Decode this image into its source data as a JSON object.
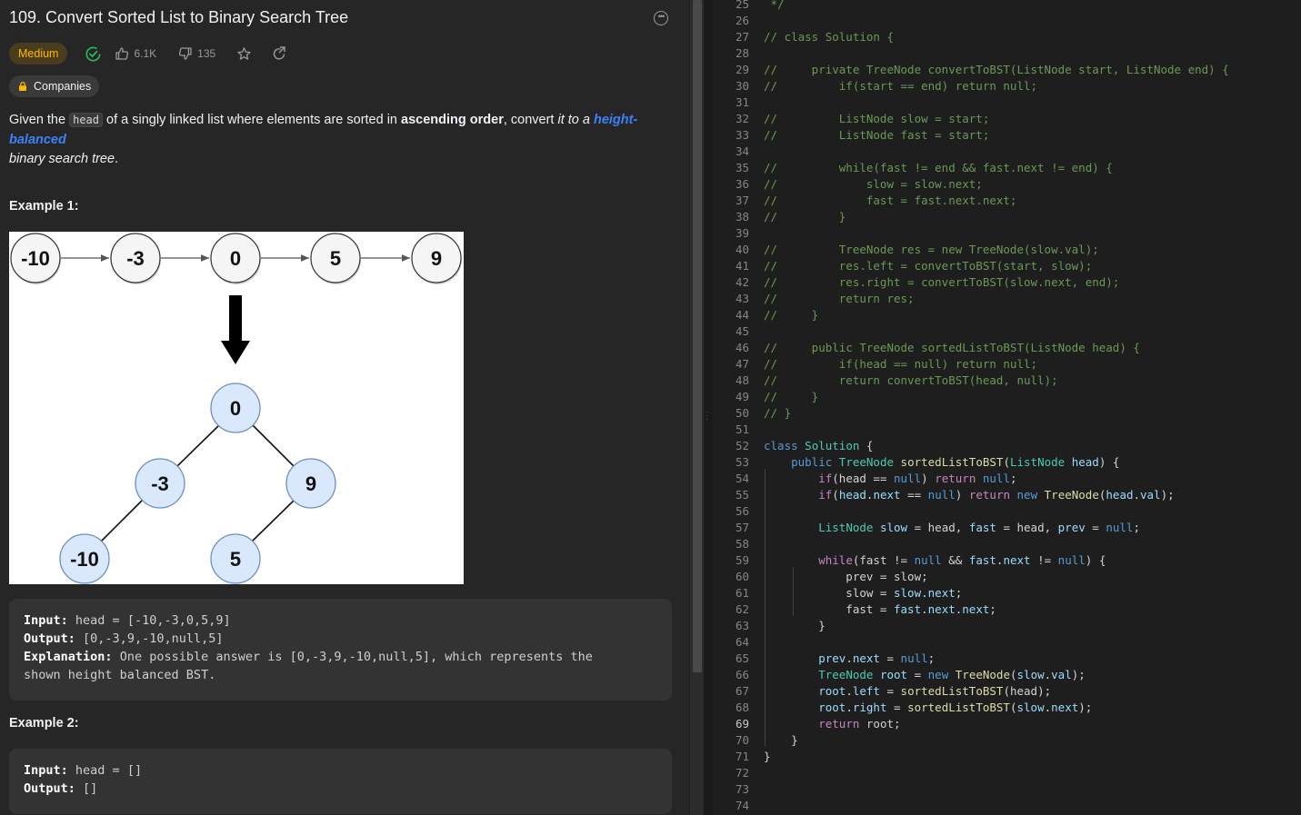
{
  "problem": {
    "title": "109. Convert Sorted List to Binary Search Tree",
    "difficulty": "Medium",
    "likes": "6.1K",
    "dislikes": "135",
    "companies_label": "Companies",
    "desc_p1": "Given the ",
    "desc_code": "head",
    "desc_p2": " of a singly linked list where elements are sorted in ",
    "desc_bold": "ascending order",
    "desc_p3": ", convert ",
    "desc_italic": "it to a ",
    "desc_link": "height-balanced",
    "desc_italic2": "binary search tree",
    "desc_end": ".",
    "example1_label": "Example 1:",
    "example2_label": "Example 2:",
    "figure": {
      "list": [
        "-10",
        "-3",
        "0",
        "5",
        "9"
      ],
      "tree": {
        "root": "0",
        "left": "-3",
        "right": "9",
        "left_left": "-10",
        "right_left": "5"
      }
    },
    "example1": {
      "input_label": "Input:",
      "input": "head = [-10,-3,0,5,9]",
      "output_label": "Output:",
      "output": "[0,-3,9,-10,null,5]",
      "expl_label": "Explanation:",
      "expl1": "One possible answer is [0,-3,9,-10,null,5], which represents the",
      "expl2": "shown height balanced BST."
    },
    "example2": {
      "input_label": "Input:",
      "input": "head = []",
      "output_label": "Output:",
      "output": "[]"
    }
  },
  "editor": {
    "current_line": 69,
    "lines": [
      {
        "n": 25,
        "t": [
          [
            "cm",
            " */"
          ]
        ]
      },
      {
        "n": 26,
        "t": []
      },
      {
        "n": 27,
        "t": [
          [
            "cm",
            "// class Solution {"
          ]
        ]
      },
      {
        "n": 28,
        "t": []
      },
      {
        "n": 29,
        "t": [
          [
            "cm",
            "//     private TreeNode convertToBST(ListNode start, ListNode end) {"
          ]
        ]
      },
      {
        "n": 30,
        "t": [
          [
            "cm",
            "//         if(start == end) return null;"
          ]
        ]
      },
      {
        "n": 31,
        "t": []
      },
      {
        "n": 32,
        "t": [
          [
            "cm",
            "//         ListNode slow = start;"
          ]
        ]
      },
      {
        "n": 33,
        "t": [
          [
            "cm",
            "//         ListNode fast = start;"
          ]
        ]
      },
      {
        "n": 34,
        "t": []
      },
      {
        "n": 35,
        "t": [
          [
            "cm",
            "//         while(fast != end && fast.next != end) {"
          ]
        ]
      },
      {
        "n": 36,
        "t": [
          [
            "cm",
            "//             slow = slow.next;"
          ]
        ]
      },
      {
        "n": 37,
        "t": [
          [
            "cm",
            "//             fast = fast.next.next;"
          ]
        ]
      },
      {
        "n": 38,
        "t": [
          [
            "cm",
            "//         }"
          ]
        ]
      },
      {
        "n": 39,
        "t": []
      },
      {
        "n": 40,
        "t": [
          [
            "cm",
            "//         TreeNode res = new TreeNode(slow.val);"
          ]
        ]
      },
      {
        "n": 41,
        "t": [
          [
            "cm",
            "//         res.left = convertToBST(start, slow);"
          ]
        ]
      },
      {
        "n": 42,
        "t": [
          [
            "cm",
            "//         res.right = convertToBST(slow.next, end);"
          ]
        ]
      },
      {
        "n": 43,
        "t": [
          [
            "cm",
            "//         return res;"
          ]
        ]
      },
      {
        "n": 44,
        "t": [
          [
            "cm",
            "//     }"
          ]
        ]
      },
      {
        "n": 45,
        "t": []
      },
      {
        "n": 46,
        "t": [
          [
            "cm",
            "//     public TreeNode sortedListToBST(ListNode head) {"
          ]
        ]
      },
      {
        "n": 47,
        "t": [
          [
            "cm",
            "//         if(head == null) return null;"
          ]
        ]
      },
      {
        "n": 48,
        "t": [
          [
            "cm",
            "//         return convertToBST(head, null);"
          ]
        ]
      },
      {
        "n": 49,
        "t": [
          [
            "cm",
            "//     }"
          ]
        ]
      },
      {
        "n": 50,
        "t": [
          [
            "cm",
            "// }"
          ]
        ]
      },
      {
        "n": 51,
        "t": []
      },
      {
        "n": 52,
        "t": [
          [
            "kw",
            "class"
          ],
          [
            "",
            " "
          ],
          [
            "ty",
            "Solution"
          ],
          [
            "",
            " {"
          ]
        ]
      },
      {
        "n": 53,
        "t": [
          [
            "",
            "    "
          ],
          [
            "kw",
            "public"
          ],
          [
            "",
            " "
          ],
          [
            "ty",
            "TreeNode"
          ],
          [
            "",
            " "
          ],
          [
            "fn",
            "sortedListToBST"
          ],
          [
            "",
            "("
          ],
          [
            "ty",
            "ListNode"
          ],
          [
            "",
            " "
          ],
          [
            "vr",
            "head"
          ],
          [
            "",
            ") {"
          ]
        ]
      },
      {
        "n": 54,
        "t": [
          [
            "",
            "        "
          ],
          [
            "kw2",
            "if"
          ],
          [
            "",
            "(head == "
          ],
          [
            "kw",
            "null"
          ],
          [
            "",
            ") "
          ],
          [
            "kw2",
            "return"
          ],
          [
            "",
            " "
          ],
          [
            "kw",
            "null"
          ],
          [
            "",
            ";"
          ]
        ]
      },
      {
        "n": 55,
        "t": [
          [
            "",
            "        "
          ],
          [
            "kw2",
            "if"
          ],
          [
            "",
            "("
          ],
          [
            "vr",
            "head"
          ],
          [
            "",
            "."
          ],
          [
            "vr",
            "next"
          ],
          [
            "",
            " == "
          ],
          [
            "kw",
            "null"
          ],
          [
            "",
            ") "
          ],
          [
            "kw2",
            "return"
          ],
          [
            "",
            " "
          ],
          [
            "kw",
            "new"
          ],
          [
            "",
            " "
          ],
          [
            "fn",
            "TreeNode"
          ],
          [
            "",
            "("
          ],
          [
            "vr",
            "head"
          ],
          [
            "",
            "."
          ],
          [
            "vr",
            "val"
          ],
          [
            "",
            ");"
          ]
        ]
      },
      {
        "n": 56,
        "t": []
      },
      {
        "n": 57,
        "t": [
          [
            "",
            "        "
          ],
          [
            "ty",
            "ListNode"
          ],
          [
            "",
            " "
          ],
          [
            "vr",
            "slow"
          ],
          [
            "",
            " = head, "
          ],
          [
            "vr",
            "fast"
          ],
          [
            "",
            " = head, "
          ],
          [
            "vr",
            "prev"
          ],
          [
            "",
            " = "
          ],
          [
            "kw",
            "null"
          ],
          [
            "",
            ";"
          ]
        ]
      },
      {
        "n": 58,
        "t": []
      },
      {
        "n": 59,
        "t": [
          [
            "",
            "        "
          ],
          [
            "kw2",
            "while"
          ],
          [
            "",
            "(fast != "
          ],
          [
            "kw",
            "null"
          ],
          [
            "",
            " && "
          ],
          [
            "vr",
            "fast"
          ],
          [
            "",
            "."
          ],
          [
            "vr",
            "next"
          ],
          [
            "",
            " != "
          ],
          [
            "kw",
            "null"
          ],
          [
            "",
            ") {"
          ]
        ]
      },
      {
        "n": 60,
        "t": [
          [
            "",
            "            prev = slow;"
          ]
        ]
      },
      {
        "n": 61,
        "t": [
          [
            "",
            "            slow = "
          ],
          [
            "vr",
            "slow"
          ],
          [
            "",
            "."
          ],
          [
            "vr",
            "next"
          ],
          [
            "",
            ";"
          ]
        ]
      },
      {
        "n": 62,
        "t": [
          [
            "",
            "            fast = "
          ],
          [
            "vr",
            "fast"
          ],
          [
            "",
            "."
          ],
          [
            "vr",
            "next"
          ],
          [
            "",
            "."
          ],
          [
            "vr",
            "next"
          ],
          [
            "",
            ";"
          ]
        ]
      },
      {
        "n": 63,
        "t": [
          [
            "",
            "        }"
          ]
        ]
      },
      {
        "n": 64,
        "t": []
      },
      {
        "n": 65,
        "t": [
          [
            "",
            "        "
          ],
          [
            "vr",
            "prev"
          ],
          [
            "",
            "."
          ],
          [
            "vr",
            "next"
          ],
          [
            "",
            " = "
          ],
          [
            "kw",
            "null"
          ],
          [
            "",
            ";"
          ]
        ]
      },
      {
        "n": 66,
        "t": [
          [
            "",
            "        "
          ],
          [
            "ty",
            "TreeNode"
          ],
          [
            "",
            " "
          ],
          [
            "vr",
            "root"
          ],
          [
            "",
            " = "
          ],
          [
            "kw",
            "new"
          ],
          [
            "",
            " "
          ],
          [
            "fn",
            "TreeNode"
          ],
          [
            "",
            "("
          ],
          [
            "vr",
            "slow"
          ],
          [
            "",
            "."
          ],
          [
            "vr",
            "val"
          ],
          [
            "",
            ");"
          ]
        ]
      },
      {
        "n": 67,
        "t": [
          [
            "",
            "        "
          ],
          [
            "vr",
            "root"
          ],
          [
            "",
            "."
          ],
          [
            "vr",
            "left"
          ],
          [
            "",
            " = "
          ],
          [
            "fn",
            "sortedListToBST"
          ],
          [
            "",
            "(head);"
          ]
        ]
      },
      {
        "n": 68,
        "t": [
          [
            "",
            "        "
          ],
          [
            "vr",
            "root"
          ],
          [
            "",
            "."
          ],
          [
            "vr",
            "right"
          ],
          [
            "",
            " = "
          ],
          [
            "fn",
            "sortedListToBST"
          ],
          [
            "",
            "("
          ],
          [
            "vr",
            "slow"
          ],
          [
            "",
            "."
          ],
          [
            "vr",
            "next"
          ],
          [
            "",
            ");"
          ]
        ]
      },
      {
        "n": 69,
        "t": [
          [
            "",
            "        "
          ],
          [
            "kw2",
            "return"
          ],
          [
            "",
            " root;"
          ]
        ]
      },
      {
        "n": 70,
        "t": [
          [
            "",
            "    }"
          ]
        ]
      },
      {
        "n": 71,
        "t": [
          [
            "",
            "}"
          ]
        ]
      },
      {
        "n": 72,
        "t": []
      },
      {
        "n": 73,
        "t": []
      },
      {
        "n": 74,
        "t": []
      }
    ]
  }
}
